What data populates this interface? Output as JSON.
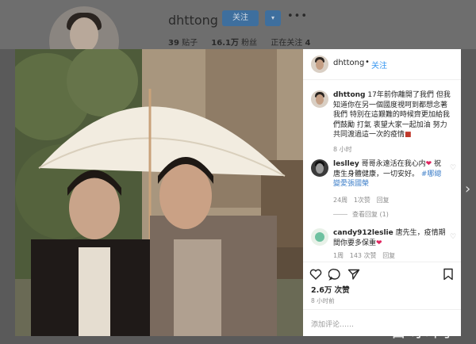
{
  "profile": {
    "username": "dhttong",
    "follow_label": "关注",
    "dropdown_label": "▾",
    "more_label": "•••",
    "posts_count": "39",
    "posts_label": "贴子",
    "followers_count": "16.1万",
    "followers_label": "粉丝",
    "following_label": "正在关注",
    "following_count": "4"
  },
  "post": {
    "header": {
      "username": "dhttong",
      "separator": "•",
      "follow_label": "关注"
    },
    "caption": {
      "username": "dhttong",
      "text": "17年前你離開了我們 但我知道你在另一個國度視呵到都想念著我們 特別在這艱難的時候齊更加給我們鼓勵 打氣 衷望大家一起加油 努力 共同渡過這一次的疫情",
      "time": "8 小时"
    },
    "comments": [
      {
        "username": "leslley",
        "text": "哥哥永遠活在我心内",
        "text2": " 祝唐生身體健康，一切安好。",
        "tag": "#哪總變愛張國榮",
        "time": "24周",
        "likes": "1次赞",
        "reply": "回复",
        "view_replies": "查看回复 (1)"
      },
      {
        "username": "candy912leslie",
        "text": "唐先生，疫情期間你要多保重",
        "time": "1周",
        "likes": "143 次赞",
        "reply": "回复"
      }
    ],
    "likes": "2.6万 次赞",
    "time": "8 小时前",
    "add_comment_placeholder": "添加评论……"
  },
  "watermark": "若水网",
  "next_arrow": "›",
  "colors": {
    "accent": "#3897f0",
    "tag": "#3e7fc9",
    "follow_button": "#3e6f9e"
  },
  "icons": [
    "heart-icon",
    "comment-icon",
    "share-icon",
    "bookmark-icon",
    "more-icon",
    "chevron-right-icon"
  ]
}
